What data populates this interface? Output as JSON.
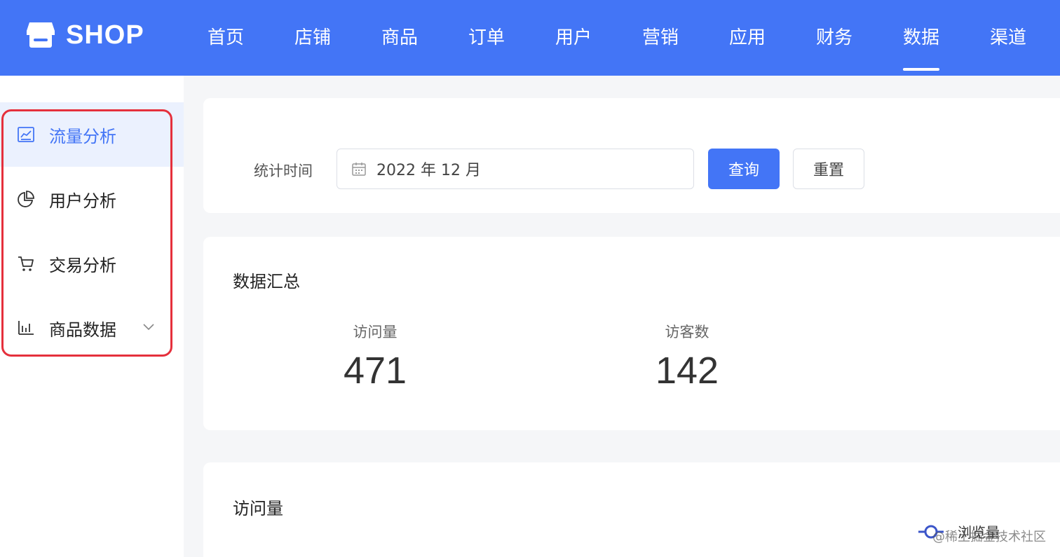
{
  "header": {
    "logo_text": "SHOP",
    "nav": [
      {
        "label": "首页"
      },
      {
        "label": "店铺"
      },
      {
        "label": "商品"
      },
      {
        "label": "订单"
      },
      {
        "label": "用户"
      },
      {
        "label": "营销"
      },
      {
        "label": "应用"
      },
      {
        "label": "财务"
      },
      {
        "label": "数据",
        "active": true
      },
      {
        "label": "渠道"
      }
    ]
  },
  "sidebar": {
    "items": [
      {
        "label": "流量分析",
        "icon": "line-chart-icon",
        "active": true
      },
      {
        "label": "用户分析",
        "icon": "pie-chart-icon"
      },
      {
        "label": "交易分析",
        "icon": "cart-icon"
      },
      {
        "label": "商品数据",
        "icon": "bar-chart-icon",
        "has_submenu": true
      }
    ]
  },
  "filter": {
    "label": "统计时间",
    "date_value": "2022 年 12 月",
    "query_label": "查询",
    "reset_label": "重置"
  },
  "summary": {
    "title": "数据汇总",
    "stats": [
      {
        "label": "访问量",
        "value": "471"
      },
      {
        "label": "访客数",
        "value": "142"
      }
    ]
  },
  "visits": {
    "title": "访问量",
    "legend_label": "浏览量"
  },
  "watermark": "@稀土掘金技术社区",
  "colors": {
    "primary": "#4375f6",
    "highlight_border": "#e5303c",
    "active_bg": "#ebf1fe"
  }
}
